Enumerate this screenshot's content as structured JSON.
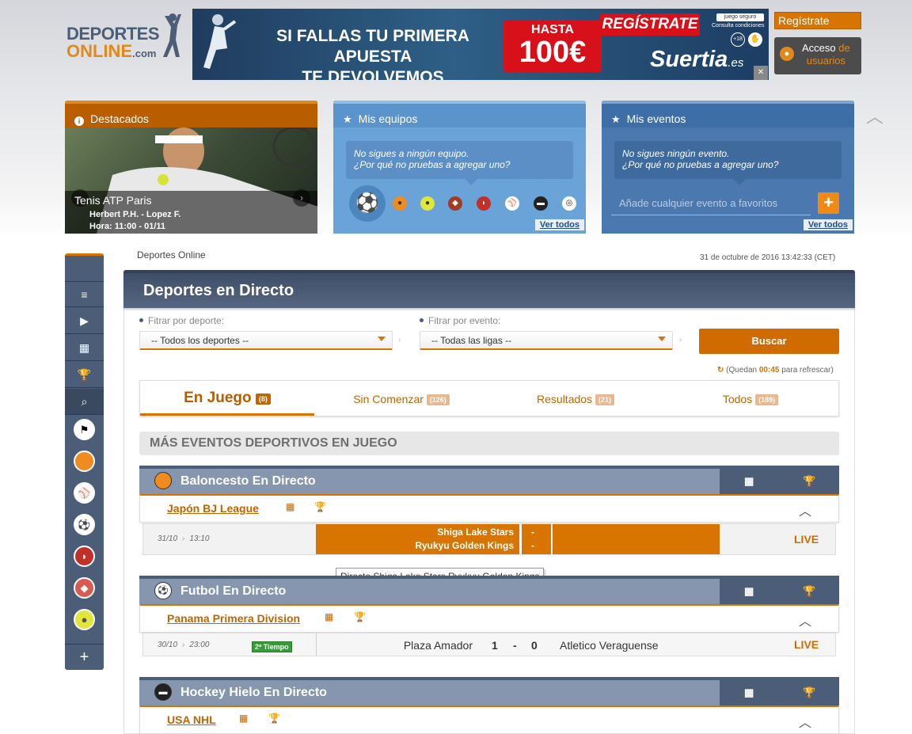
{
  "header": {
    "logo_line1": "DEPORTES",
    "logo_line2": "ONLINE",
    "logo_suffix": ".com",
    "register_label": "Regístrate",
    "access_label_1": "Acceso",
    "access_label_de": "de",
    "access_label_2": "usuarios"
  },
  "banner": {
    "headline_1": "SI FALLAS TU PRIMERA APUESTA",
    "headline_2": "TE DEVOLVEMOS",
    "hasta": "HASTA",
    "amount": "100€",
    "register_cta": "REGÍSTRATE",
    "juego_seguro": "juego seguro",
    "conditions": "Consulta condiciones",
    "age": "+18",
    "brand": "Suertia",
    "brand_tld": ".es"
  },
  "destacados": {
    "title": "Destacados",
    "event_title": "Tenis ATP Paris",
    "players": "Herbert P.H. - Lopez F.",
    "time": "Hora: 11:00 - 01/11"
  },
  "mis_equipos": {
    "title": "Mis equipos",
    "message_1": "No sigues a ningún equipo.",
    "message_2": "¿Por qué no pruebas a agregar uno?",
    "ver_todos": "Ver todos"
  },
  "mis_eventos": {
    "title": "Mis eventos",
    "message_1": "No sigues ningún evento.",
    "message_2": "¿Por qué no pruebas a agregar uno?",
    "placeholder": "Añade cualquier evento a favoritos",
    "add": "+",
    "ver_todos": "Ver todos"
  },
  "breadcrumb": "Deportes Online",
  "datetime": "31 de octubre de 2016  13:42:33 (CET)",
  "page_title": "Deportes en Directo",
  "filters": {
    "sport_label": "Fitrar por deporte:",
    "sport_value": "-- Todos los deportes --",
    "event_label": "Fitrar por evento:",
    "event_value": "-- Todas las ligas --",
    "search_button": "Buscar"
  },
  "refresh": {
    "prefix": "(Quedan",
    "time": "00:45",
    "suffix": "para refrescar)"
  },
  "tabs": [
    {
      "label": "En Juego",
      "count": "(8)"
    },
    {
      "label": "Sin Comenzar",
      "count": "(126)"
    },
    {
      "label": "Resultados",
      "count": "(21)"
    },
    {
      "label": "Todos",
      "count": "(189)"
    }
  ],
  "more_events": "MÁS EVENTOS DEPORTIVOS EN JUEGO",
  "sections": [
    {
      "title": "Baloncesto En Directo",
      "league": "Japón BJ League",
      "date": "31/10",
      "time": "13:10",
      "home": "Shiga Lake Stars",
      "away": "Ryukyu Golden Kings",
      "score_home": "-",
      "score_away": "-",
      "status": "LIVE"
    },
    {
      "title": "Futbol En Directo",
      "league": "Panama Primera Division",
      "date": "30/10",
      "time": "23:00",
      "period": "2º Tiempo",
      "home": "Plaza Amador",
      "score_home": "1",
      "score_sep": "-",
      "score_away": "0",
      "away": "Atletico Veraguense",
      "status": "LIVE"
    },
    {
      "title": "Hockey Hielo En Directo",
      "league": "USA NHL"
    }
  ],
  "tooltip": "Directo Shiga Lake Stars Ryukyu Golden Kings",
  "colors": {
    "accent": "#d87400",
    "navy": "#4c5d78",
    "equipos": "#6aa3d8",
    "eventos": "#4b78ae"
  }
}
